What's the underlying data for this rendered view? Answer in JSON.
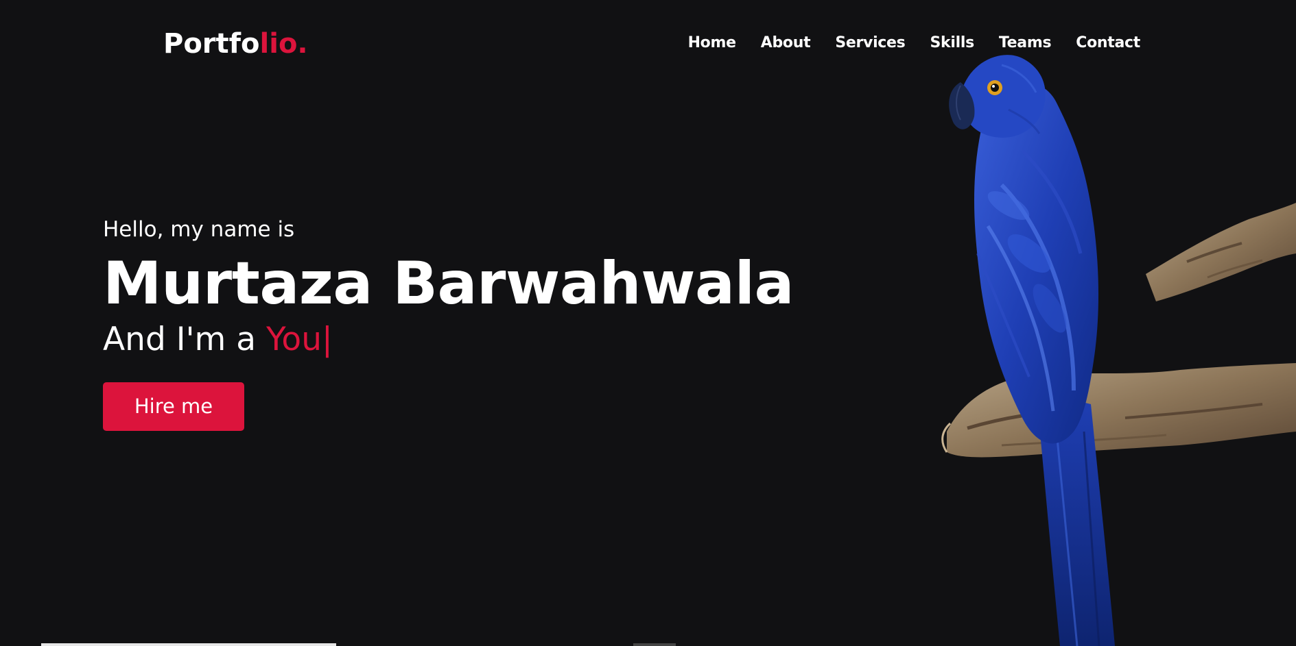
{
  "brand": {
    "logo_main": "Portfo",
    "logo_accent": "lio."
  },
  "nav": {
    "items": [
      {
        "label": "Home"
      },
      {
        "label": "About"
      },
      {
        "label": "Services"
      },
      {
        "label": "Skills"
      },
      {
        "label": "Teams"
      },
      {
        "label": "Contact"
      }
    ]
  },
  "hero": {
    "greeting": "Hello, my name is",
    "name": "Murtaza Barwahwala",
    "role_prefix": "And I'm a ",
    "role_typed": "You",
    "cursor": "|",
    "cta_label": "Hire me"
  },
  "colors": {
    "background": "#111113",
    "accent": "#dc143c",
    "text": "#ffffff"
  },
  "images": {
    "hero_image": "blue-macaw-on-branch"
  }
}
